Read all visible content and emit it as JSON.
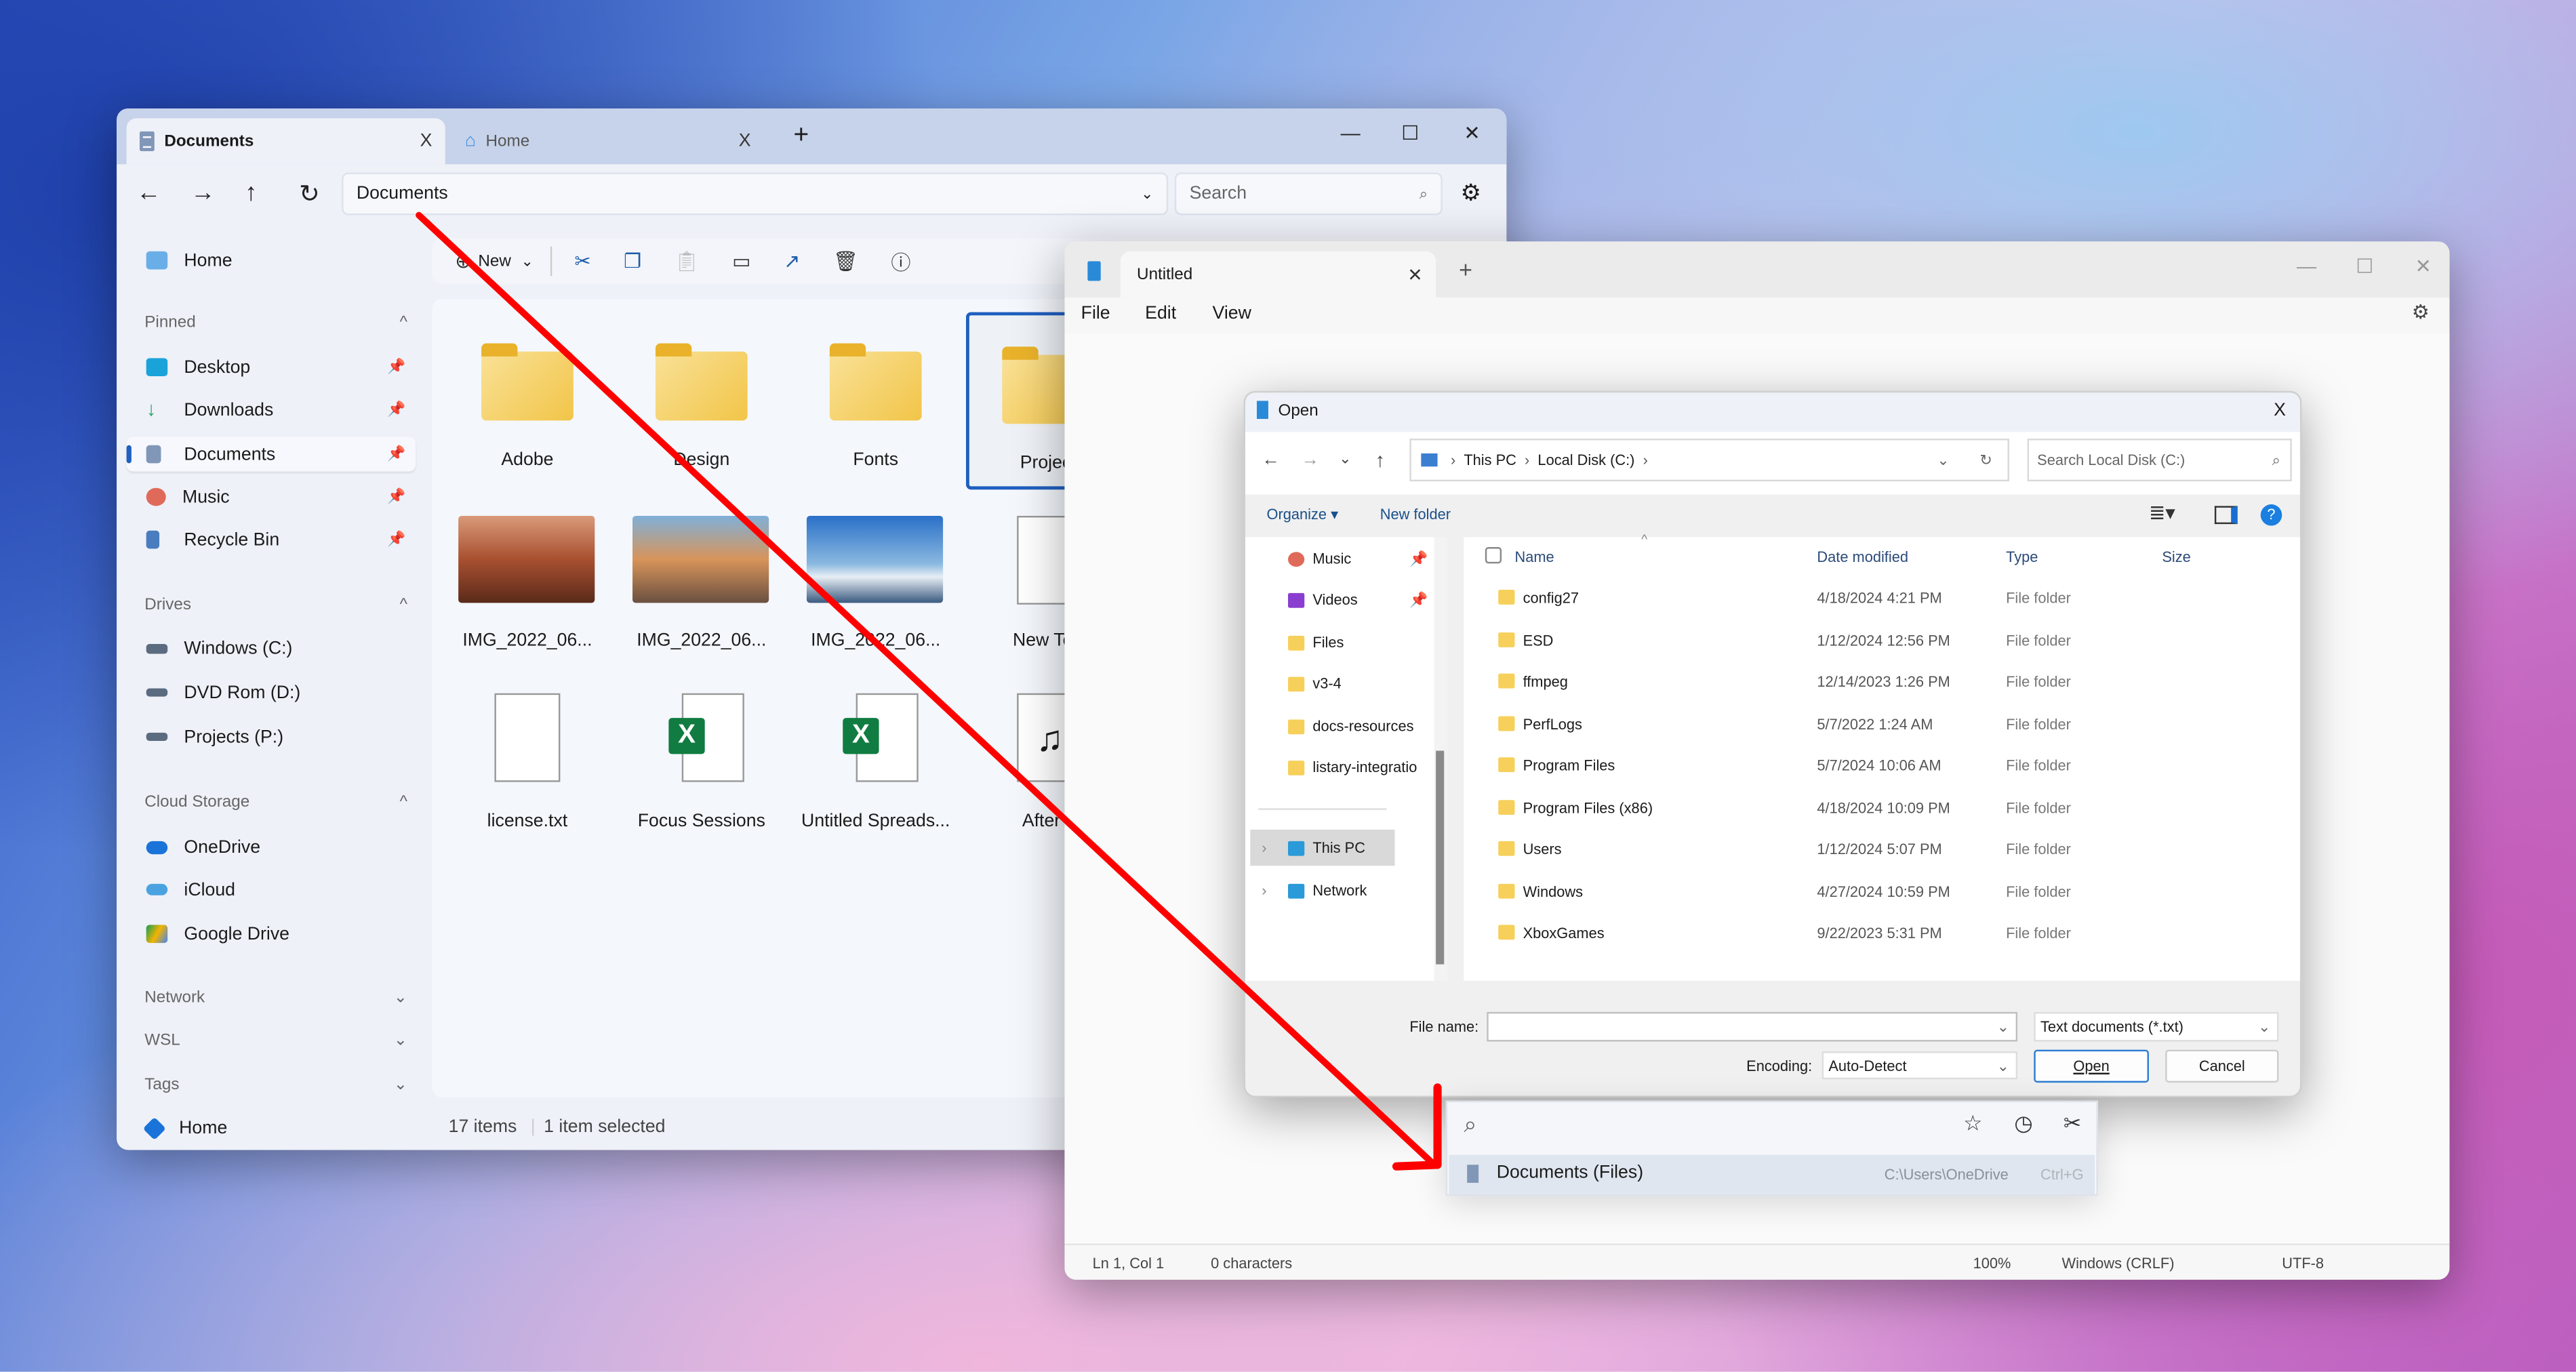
{
  "explorer": {
    "tabs": [
      {
        "label": "Documents",
        "close": "X"
      },
      {
        "label": "Home",
        "close": "X"
      }
    ],
    "new_tab": "+",
    "window_controls": {
      "minimize": "—",
      "maximize": "☐",
      "close": "✕"
    },
    "address": "Documents",
    "search_placeholder": "Search",
    "toolbar": {
      "new_label": "New"
    },
    "sidebar": {
      "home": "Home",
      "pinned_header": "Pinned",
      "pinned": [
        {
          "label": "Desktop",
          "color": "#1aa3d9"
        },
        {
          "label": "Downloads",
          "color": "#21a366"
        },
        {
          "label": "Documents",
          "color": "#8197b8"
        },
        {
          "label": "Music",
          "color": "#e06a5a"
        },
        {
          "label": "Recycle Bin",
          "color": "#4a7cc0"
        }
      ],
      "drives_header": "Drives",
      "drives": [
        {
          "label": "Windows (C:)"
        },
        {
          "label": "DVD Rom (D:)"
        },
        {
          "label": "Projects (P:)"
        }
      ],
      "cloud_header": "Cloud Storage",
      "cloud": [
        {
          "label": "OneDrive",
          "color": "#1a73d9"
        },
        {
          "label": "iCloud",
          "color": "#4aa3e0"
        },
        {
          "label": "Google Drive",
          "color": "#f4b400"
        }
      ],
      "network_header": "Network",
      "wsl_header": "WSL",
      "tags_header": "Tags",
      "bottom_home": "Home"
    },
    "items": [
      "Adobe",
      "Design",
      "Fonts",
      "Project",
      "IMG_2022_06...",
      "IMG_2022_06...",
      "IMG_2022_06...",
      "New Text",
      "license.txt",
      "Focus Sessions",
      "Untitled Spreads...",
      "After E"
    ],
    "status": {
      "count": "17 items",
      "selected": "1 item selected"
    }
  },
  "notepad": {
    "tab": "Untitled",
    "tab_close": "✕",
    "new_tab": "+",
    "menu": [
      "File",
      "Edit",
      "View"
    ],
    "status": {
      "position": "Ln 1, Col 1",
      "chars": "0 characters",
      "zoom": "100%",
      "line_ending": "Windows (CRLF)",
      "encoding": "UTF-8"
    }
  },
  "open_dialog": {
    "title": "Open",
    "close": "X",
    "breadcrumb": [
      "This PC",
      "Local Disk (C:)"
    ],
    "search_placeholder": "Search Local Disk (C:)",
    "organize": "Organize ▾",
    "new_folder": "New folder",
    "nav": [
      {
        "label": "Music"
      },
      {
        "label": "Videos"
      },
      {
        "label": "Files"
      },
      {
        "label": "v3-4"
      },
      {
        "label": "docs-resources"
      },
      {
        "label": "listary-integratio"
      },
      {
        "label": "This PC"
      },
      {
        "label": "Network"
      }
    ],
    "columns": [
      "Name",
      "Date modified",
      "Type",
      "Size"
    ],
    "rows": [
      {
        "name": "config27",
        "date": "4/18/2024 4:21 PM",
        "type": "File folder"
      },
      {
        "name": "ESD",
        "date": "1/12/2024 12:56 PM",
        "type": "File folder"
      },
      {
        "name": "ffmpeg",
        "date": "12/14/2023 1:26 PM",
        "type": "File folder"
      },
      {
        "name": "PerfLogs",
        "date": "5/7/2022 1:24 AM",
        "type": "File folder"
      },
      {
        "name": "Program Files",
        "date": "5/7/2024 10:06 AM",
        "type": "File folder"
      },
      {
        "name": "Program Files (x86)",
        "date": "4/18/2024 10:09 PM",
        "type": "File folder"
      },
      {
        "name": "Users",
        "date": "1/12/2024 5:07 PM",
        "type": "File folder"
      },
      {
        "name": "Windows",
        "date": "4/27/2024 10:59 PM",
        "type": "File folder"
      },
      {
        "name": "XboxGames",
        "date": "9/22/2023 5:31 PM",
        "type": "File folder"
      }
    ],
    "file_name_label": "File name:",
    "file_name_value": "",
    "file_type": "Text documents (*.txt)",
    "encoding_label": "Encoding:",
    "encoding_value": "Auto-Detect",
    "open": "Open",
    "cancel": "Cancel"
  },
  "listary": {
    "result": {
      "name": "Documents (Files)",
      "path": "C:\\Users\\OneDrive",
      "shortcut": "Ctrl+G"
    }
  },
  "colors": {
    "arrow": "#ff0000",
    "accent": "#1f5fbf",
    "folder": "#f2c548"
  }
}
